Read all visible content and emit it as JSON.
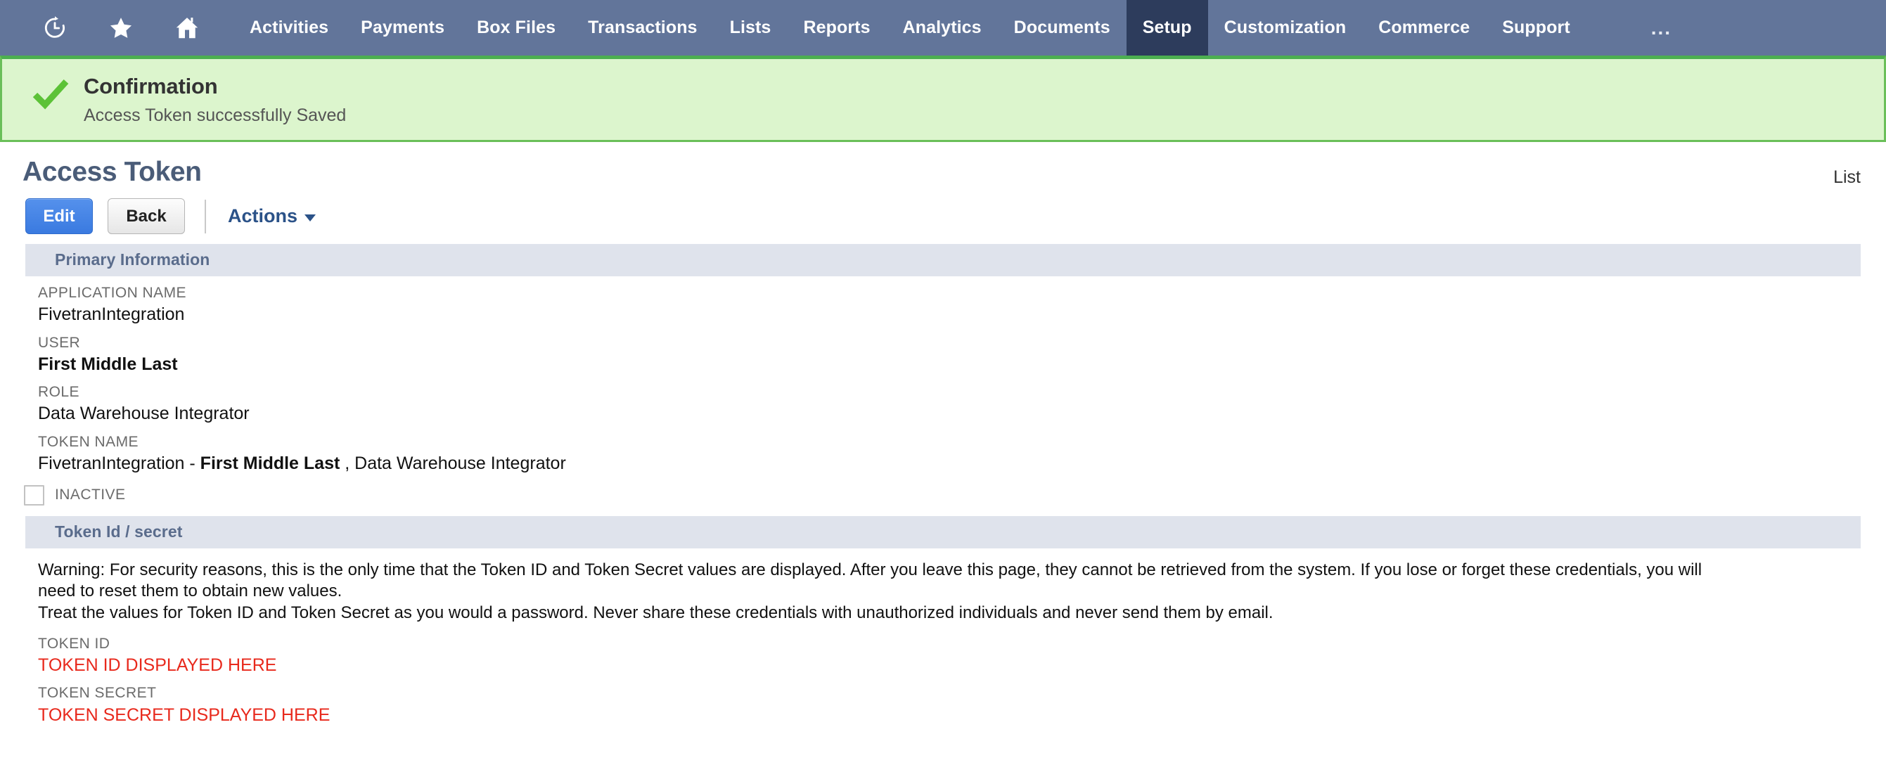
{
  "navbar": {
    "icons": [
      {
        "name": "recent-history-icon",
        "label": "Recent Records"
      },
      {
        "name": "favorites-star-icon",
        "label": "Shortcuts"
      },
      {
        "name": "home-icon",
        "label": "Home"
      }
    ],
    "items": [
      {
        "label": "Activities",
        "active": false
      },
      {
        "label": "Payments",
        "active": false
      },
      {
        "label": "Box Files",
        "active": false
      },
      {
        "label": "Transactions",
        "active": false
      },
      {
        "label": "Lists",
        "active": false
      },
      {
        "label": "Reports",
        "active": false
      },
      {
        "label": "Analytics",
        "active": false
      },
      {
        "label": "Documents",
        "active": false
      },
      {
        "label": "Setup",
        "active": true
      },
      {
        "label": "Customization",
        "active": false
      },
      {
        "label": "Commerce",
        "active": false
      },
      {
        "label": "Support",
        "active": false
      }
    ],
    "overflow_label": "...",
    "background_color": "#62759a",
    "active_background_color": "#2d3c5c"
  },
  "confirmation": {
    "icon": "green-checkmark-icon",
    "title": "Confirmation",
    "message": "Access Token successfully Saved",
    "background_color": "#dcf5cd",
    "border_color": "#6abf59",
    "check_color": "#5cc237"
  },
  "page": {
    "title": "Access Token",
    "list_link": "List",
    "title_color": "#4a5c78"
  },
  "toolbar": {
    "edit_label": "Edit",
    "back_label": "Back",
    "actions_label": "Actions",
    "primary_color": "#3a7ae0"
  },
  "primary_information": {
    "section_title": "Primary Information",
    "fields": [
      {
        "label": "APPLICATION NAME",
        "value": "FivetranIntegration",
        "bold": false
      },
      {
        "label": "USER",
        "value": "First Middle Last",
        "bold": true
      },
      {
        "label": "ROLE",
        "value": "Data Warehouse Integrator",
        "bold": false
      }
    ],
    "token_name": {
      "label": "TOKEN NAME",
      "prefix": "FivetranIntegration - ",
      "user": "First Middle Last",
      "suffix": " , Data Warehouse Integrator",
      "full_value": "FivetranIntegration -  First Middle Last , Data Warehouse Integrator"
    },
    "inactive_checkbox": {
      "label": "INACTIVE",
      "checked": false
    }
  },
  "token_section": {
    "section_title": "Token Id / secret",
    "warning_line_1": "Warning: For security reasons, this is the only time that the Token ID and Token Secret values are displayed. After you leave this page, they cannot be retrieved from the system. If you lose or forget these credentials, you will",
    "warning_line_2": "need to reset them to obtain new values.",
    "warning_line_3": "Treat the values for Token ID and Token Secret as you would a password. Never share these credentials with unauthorized individuals and never send them by email.",
    "token_id_label": "TOKEN ID",
    "token_id_value": "TOKEN ID DISPLAYED HERE",
    "token_secret_label": "TOKEN SECRET",
    "token_secret_value": "TOKEN SECRET DISPLAYED HERE",
    "value_color": "#e8291c"
  }
}
